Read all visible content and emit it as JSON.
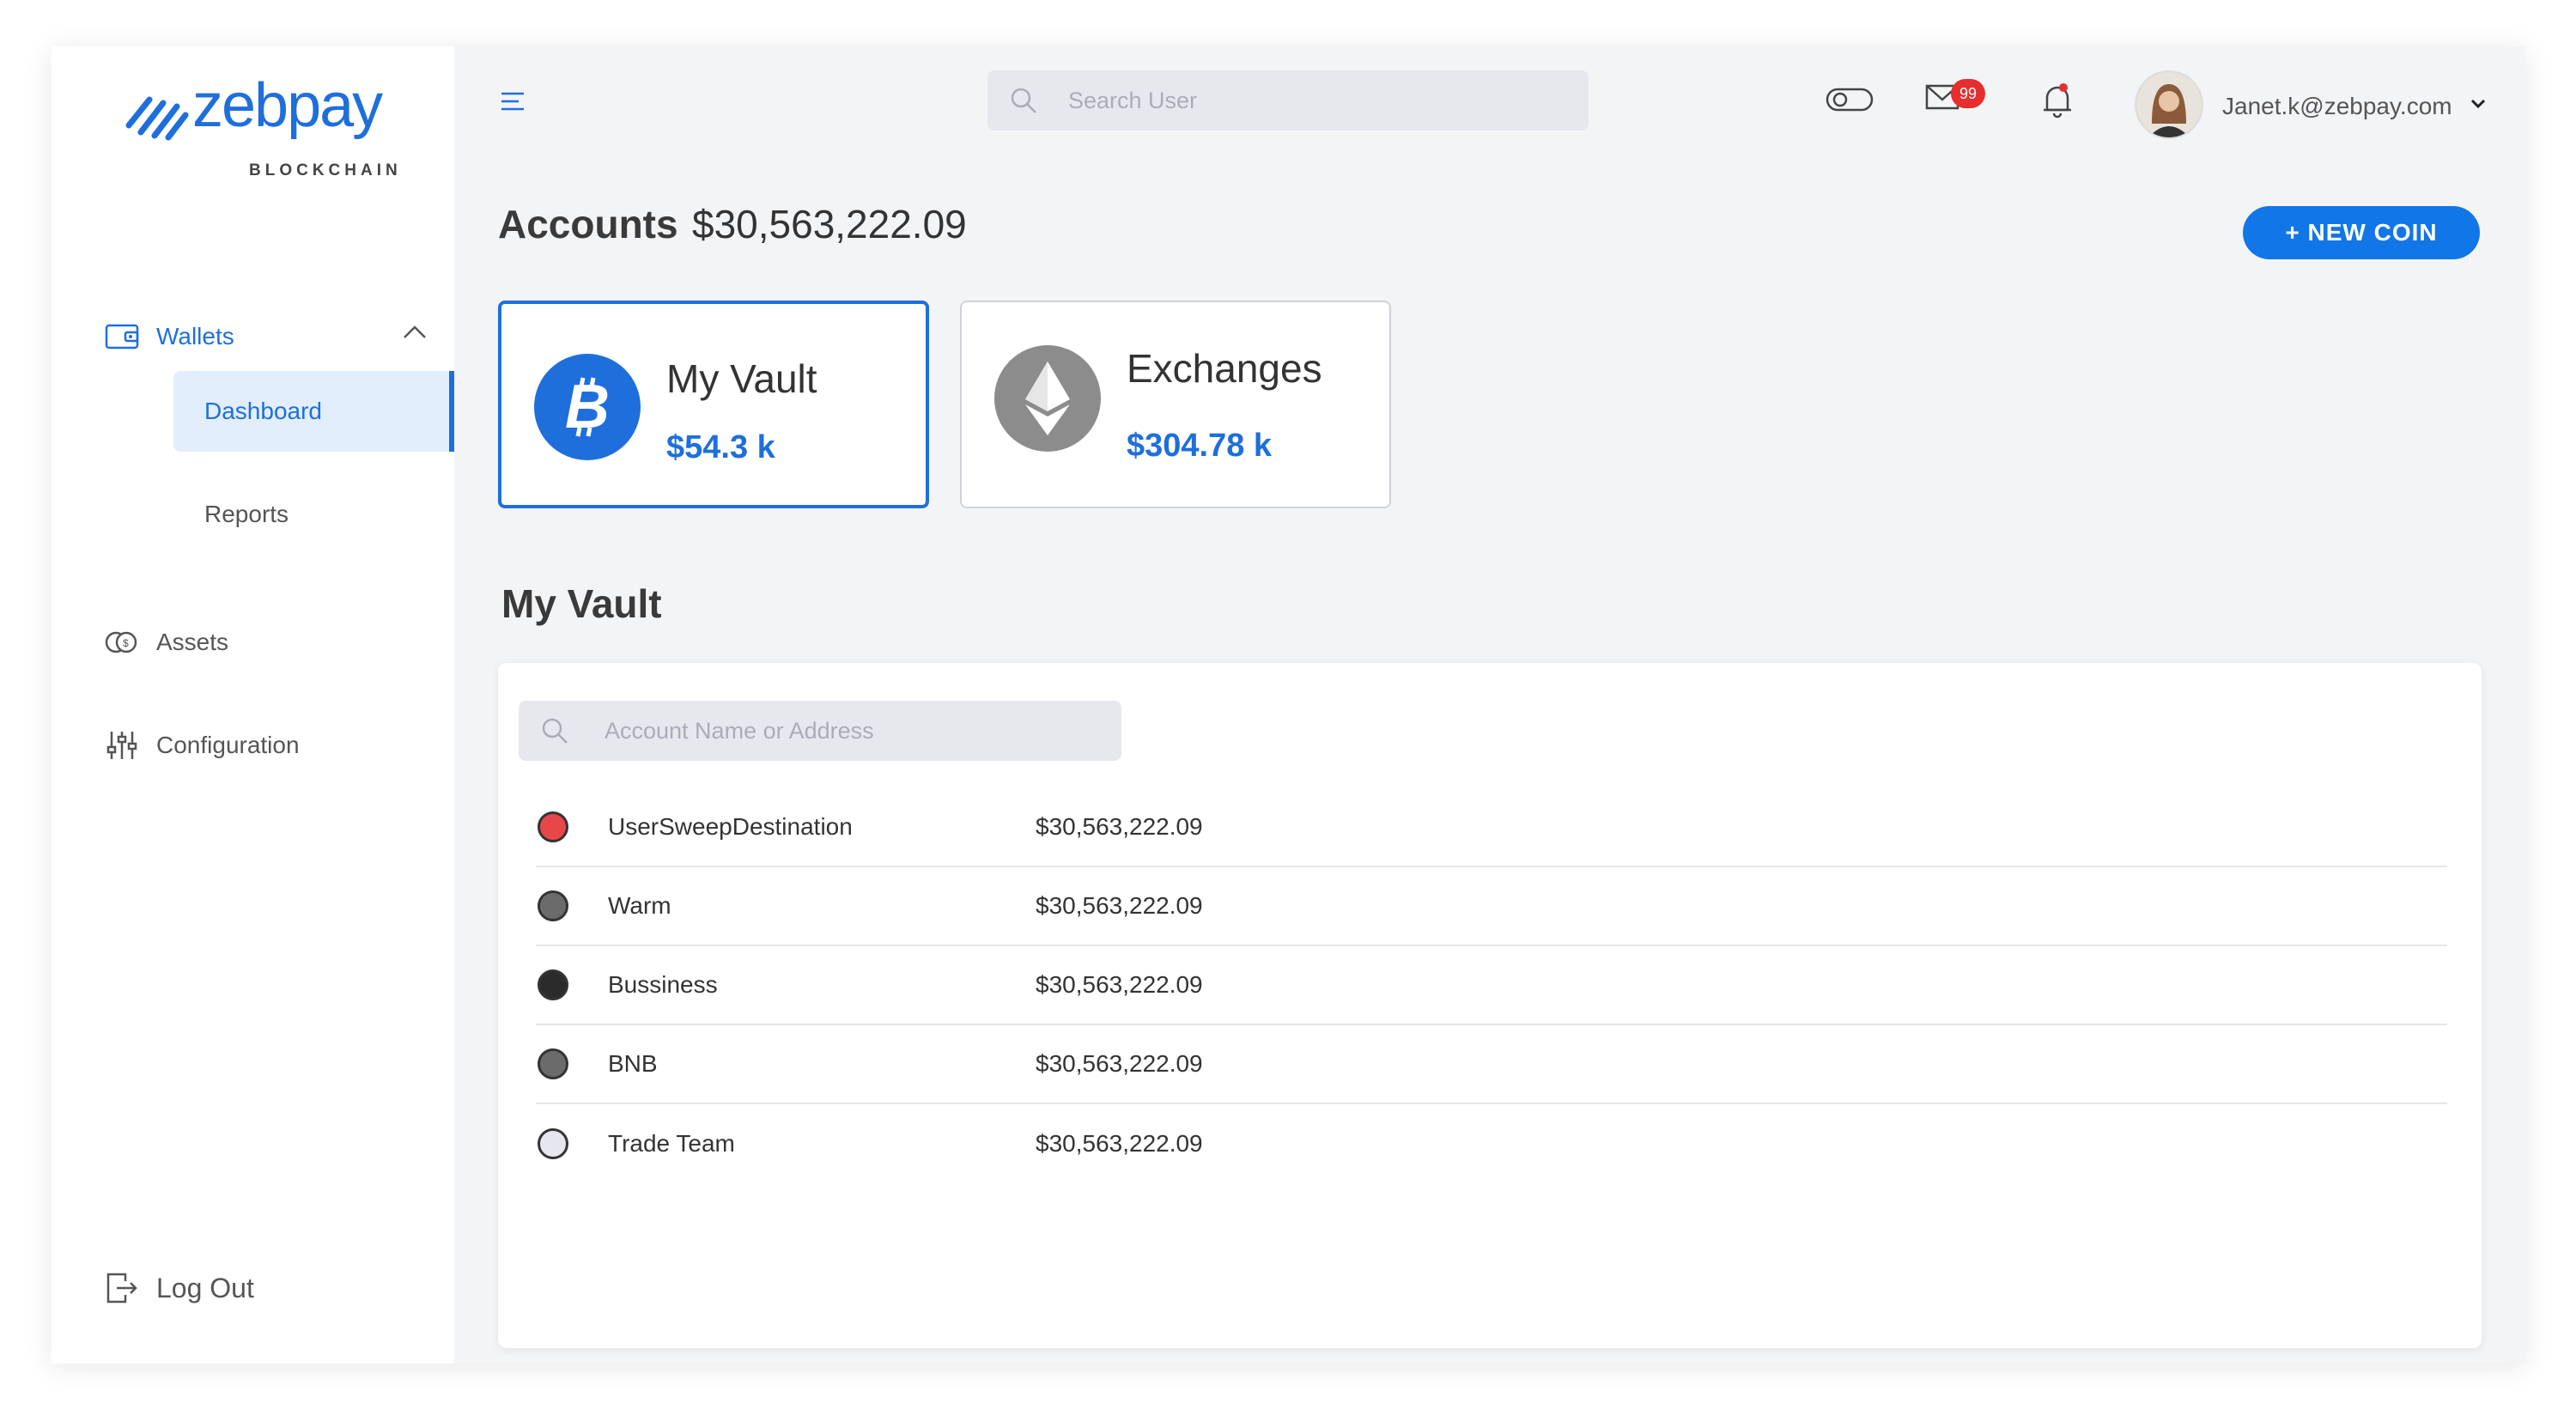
{
  "brand": {
    "name": "zebpay",
    "sub": "BLOCKCHAIN",
    "color": "#1e6fdc"
  },
  "sidebar": {
    "wallets": "Wallets",
    "dashboard": "Dashboard",
    "reports": "Reports",
    "assets": "Assets",
    "configuration": "Configuration",
    "logout": "Log Out"
  },
  "header": {
    "search_placeholder": "Search User",
    "mail_badge": "99",
    "user_email": "Janet.k@zebpay.com"
  },
  "accounts": {
    "title": "Accounts",
    "total": "$30,563,222.09",
    "new_coin": "+ NEW COIN"
  },
  "cards": [
    {
      "name": "My Vault",
      "value": "$54.3 k",
      "icon": "bitcoin-icon"
    },
    {
      "name": "Exchanges",
      "value": "$304.78 k",
      "icon": "ethereum-icon"
    }
  ],
  "vault": {
    "title": "My Vault",
    "search_placeholder": "Account Name or Address",
    "rows": [
      {
        "name": "UserSweepDestination",
        "value": "$30,563,222.09",
        "color": "#e8474a"
      },
      {
        "name": "Warm",
        "value": "$30,563,222.09",
        "color": "#6b6b6b"
      },
      {
        "name": "Bussiness",
        "value": "$30,563,222.09",
        "color": "#2b2b2b"
      },
      {
        "name": "BNB",
        "value": "$30,563,222.09",
        "color": "#6b6b6b"
      },
      {
        "name": "Trade Team",
        "value": "$30,563,222.09",
        "color": "#e6e6ee"
      }
    ]
  }
}
